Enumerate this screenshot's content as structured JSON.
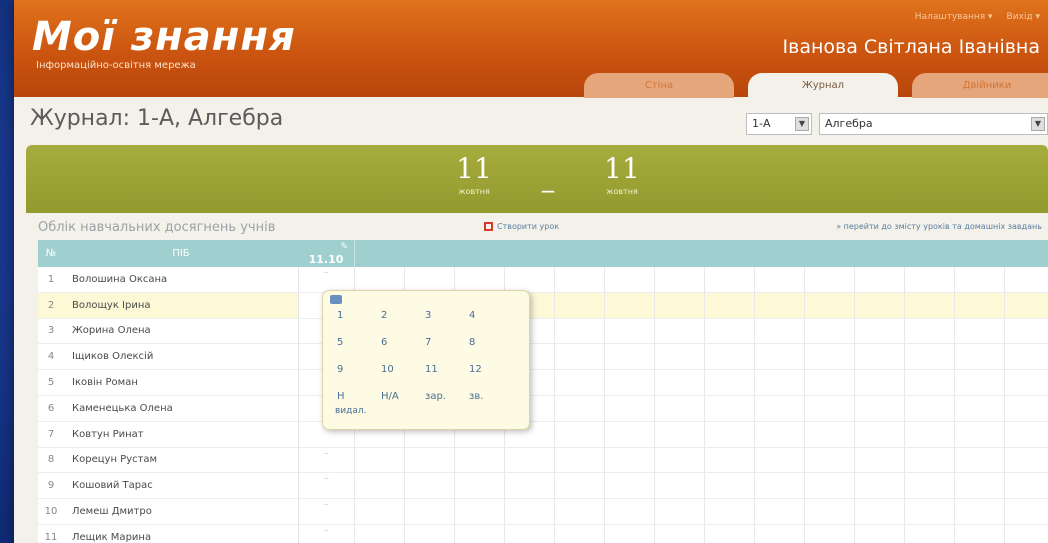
{
  "header": {
    "logo_title": "Мої знання",
    "logo_subtitle": "Інформаційно-освітня мережа",
    "user_links": [
      "Налаштування ▾",
      "Вихід ▾"
    ],
    "user_name": "Іванова Світлана Іванівна",
    "tabs": [
      {
        "label": "Стіна",
        "active": false
      },
      {
        "label": "Журнал",
        "active": true
      },
      {
        "label": "Двійники",
        "active": false
      }
    ]
  },
  "page": {
    "title": "Журнал: 1-А, Алгебра",
    "class_select": "1-А",
    "subject_select": "Алгебра"
  },
  "date_range": {
    "start_day": "11",
    "start_month": "жовтня",
    "separator": "_",
    "end_day": "11",
    "end_month": "жовтня"
  },
  "section": {
    "title": "Облік навчальних досягнень учнів",
    "create_link": "Створити урок",
    "goto_link": "» перейти до змісту уроків та домашніх завдань"
  },
  "table": {
    "col_num": "№",
    "col_name": "ПІБ",
    "col_date": "11.10",
    "rows": [
      {
        "num": "1",
        "name": "Волошина Оксана"
      },
      {
        "num": "2",
        "name": "Волощук Ірина"
      },
      {
        "num": "3",
        "name": "Жорина Олена"
      },
      {
        "num": "4",
        "name": "Іщиков Олексій"
      },
      {
        "num": "5",
        "name": "Іковін Роман"
      },
      {
        "num": "6",
        "name": "Каменецька Олена"
      },
      {
        "num": "7",
        "name": "Ковтун Ринат"
      },
      {
        "num": "8",
        "name": "Корецун Рустам"
      },
      {
        "num": "9",
        "name": "Кошовий Тарас"
      },
      {
        "num": "10",
        "name": "Лемеш Дмитро"
      },
      {
        "num": "11",
        "name": "Лещик Марина"
      }
    ]
  },
  "grade_popup": {
    "grades": [
      "1",
      "2",
      "3",
      "4",
      "5",
      "6",
      "7",
      "8",
      "9",
      "10",
      "11",
      "12",
      "Н",
      "Н/А",
      "зар.",
      "зв."
    ],
    "extra": "видал."
  }
}
